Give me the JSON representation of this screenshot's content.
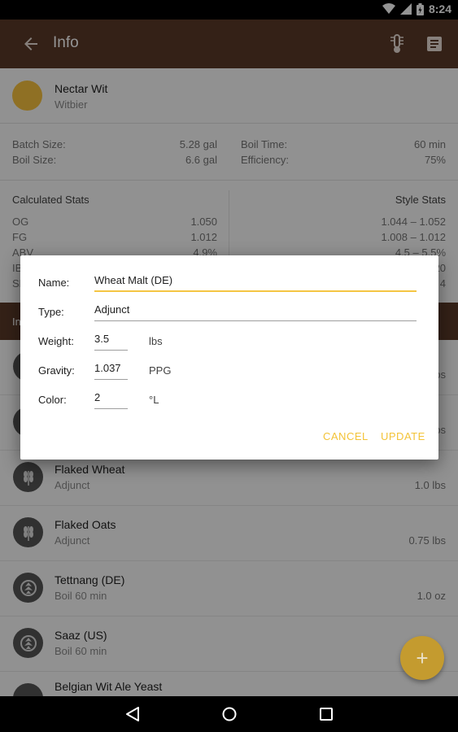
{
  "status_bar": {
    "time": "8:24"
  },
  "app_bar": {
    "title": "Info",
    "back_icon": "arrow-back-icon",
    "actions": [
      "thermometer-icon",
      "notes-icon"
    ]
  },
  "recipe": {
    "name": "Nectar Wit",
    "style": "Witbier",
    "color": "#f6c23e"
  },
  "batch_info": {
    "batch_size_label": "Batch Size:",
    "batch_size": "5.28 gal",
    "boil_size_label": "Boil Size:",
    "boil_size": "6.6 gal",
    "boil_time_label": "Boil Time:",
    "boil_time": "60 min",
    "efficiency_label": "Efficiency:",
    "efficiency": "75%"
  },
  "stats": {
    "calculated_header": "Calculated Stats",
    "style_header": "Style Stats",
    "rows": [
      {
        "label": "OG",
        "calc": "1.050",
        "style": "1.044 – 1.052"
      },
      {
        "label": "FG",
        "calc": "1.012",
        "style": "1.008 – 1.012"
      },
      {
        "label": "ABV",
        "calc": "4.9%",
        "style": "4.5 – 5.5%"
      },
      {
        "label": "IBU",
        "calc": "",
        "style": "20"
      },
      {
        "label": "SRM",
        "calc": "",
        "style": "4"
      }
    ]
  },
  "ingredients_header": "In",
  "ingredients": [
    {
      "name": "",
      "sub": "",
      "amount": "lbs",
      "icon": "grain-icon"
    },
    {
      "name": "",
      "sub": "",
      "amount": "lbs",
      "icon": "grain-icon"
    },
    {
      "name": "Flaked Wheat",
      "sub": "Adjunct",
      "amount": "1.0 lbs",
      "icon": "grain-icon"
    },
    {
      "name": "Flaked Oats",
      "sub": "Adjunct",
      "amount": "0.75 lbs",
      "icon": "grain-icon"
    },
    {
      "name": "Tettnang (DE)",
      "sub": "Boil 60 min",
      "amount": "1.0 oz",
      "icon": "hop-icon"
    },
    {
      "name": "Saaz (US)",
      "sub": "Boil 60 min",
      "amount": "",
      "icon": "hop-icon"
    },
    {
      "name": "Belgian Wit Ale Yeast",
      "sub": "",
      "amount": "",
      "icon": "yeast-icon"
    }
  ],
  "fab": {
    "label": "+"
  },
  "dialog": {
    "name_label": "Name:",
    "name_value": "Wheat Malt (DE)",
    "type_label": "Type:",
    "type_value": "Adjunct",
    "weight_label": "Weight:",
    "weight_value": "3.5",
    "weight_unit": "lbs",
    "gravity_label": "Gravity:",
    "gravity_value": "1.037",
    "gravity_unit": "PPG",
    "color_label": "Color:",
    "color_value": "2",
    "color_unit": "°L",
    "cancel_label": "CANCEL",
    "update_label": "UPDATE",
    "accent_color": "#f3c337"
  },
  "nav_bar": {
    "back": "nav-back-icon",
    "home": "nav-home-icon",
    "recents": "nav-recents-icon"
  }
}
